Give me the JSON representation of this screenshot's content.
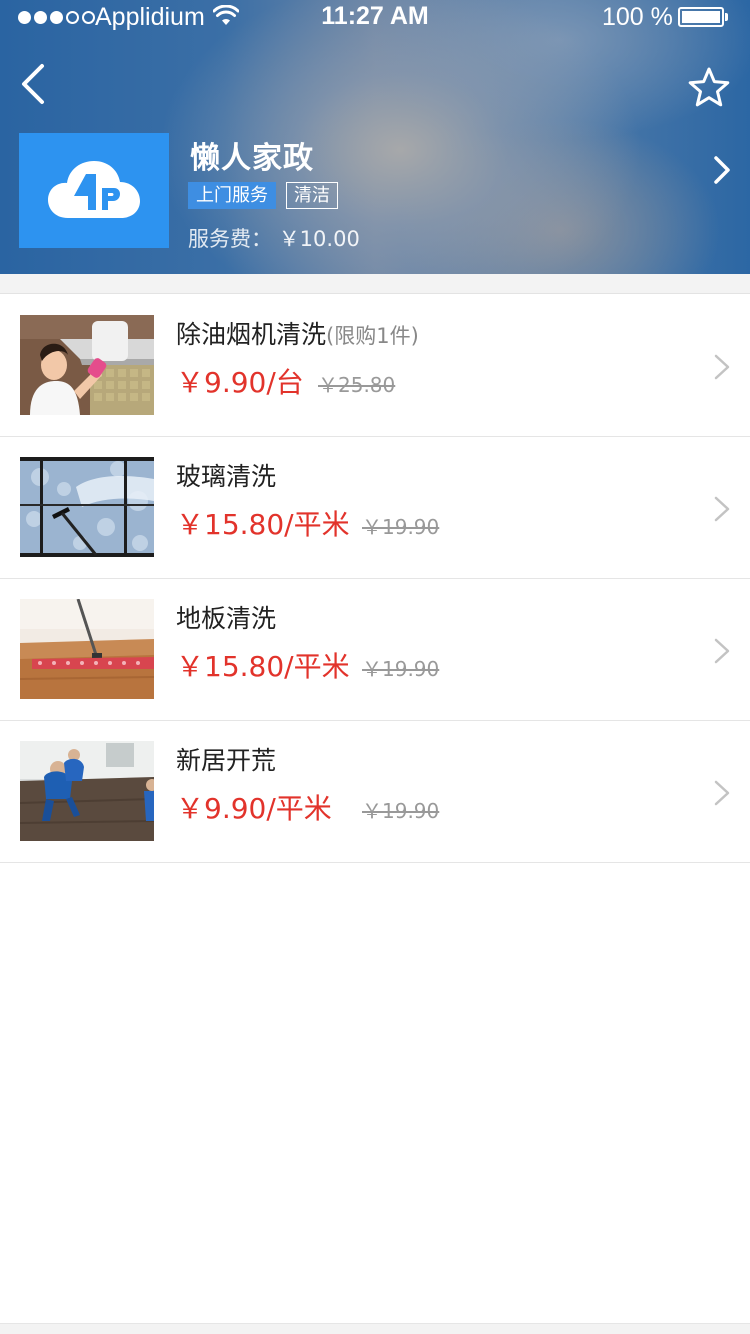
{
  "status_bar": {
    "carrier": "Applidium",
    "time": "11:27 AM",
    "battery_text": "100 %",
    "battery_level": 1.0,
    "signal_bars_filled": 3,
    "signal_bars_total": 5
  },
  "shop": {
    "name": "懒人家政",
    "tags": [
      "上门服务",
      "清洁"
    ],
    "fee_label": "服务费：",
    "fee_price": "￥10.00",
    "logo_icon": "cloud-logo-icon",
    "logo_color": "#2d93f0"
  },
  "services": [
    {
      "title": "除油烟机清洗",
      "limit": "(限购1件)",
      "price": "￥9.90/台",
      "original_price": "￥25.80",
      "image": "kitchen-hood-cleaning-photo"
    },
    {
      "title": "玻璃清洗",
      "limit": "",
      "price": "￥15.80/平米",
      "original_price": "￥19.90",
      "image": "window-cleaning-photo"
    },
    {
      "title": "地板清洗",
      "limit": "",
      "price": "￥15.80/平米",
      "original_price": "￥19.90",
      "image": "floor-mopping-photo"
    },
    {
      "title": "新居开荒",
      "limit": "",
      "price": "￥9.90/平米",
      "original_price": "￥19.90",
      "image": "new-home-cleaning-photo"
    }
  ],
  "colors": {
    "price_red": "#e2332b",
    "header_blue": "#2a64a2",
    "tag_blue": "#3e8ee2"
  }
}
